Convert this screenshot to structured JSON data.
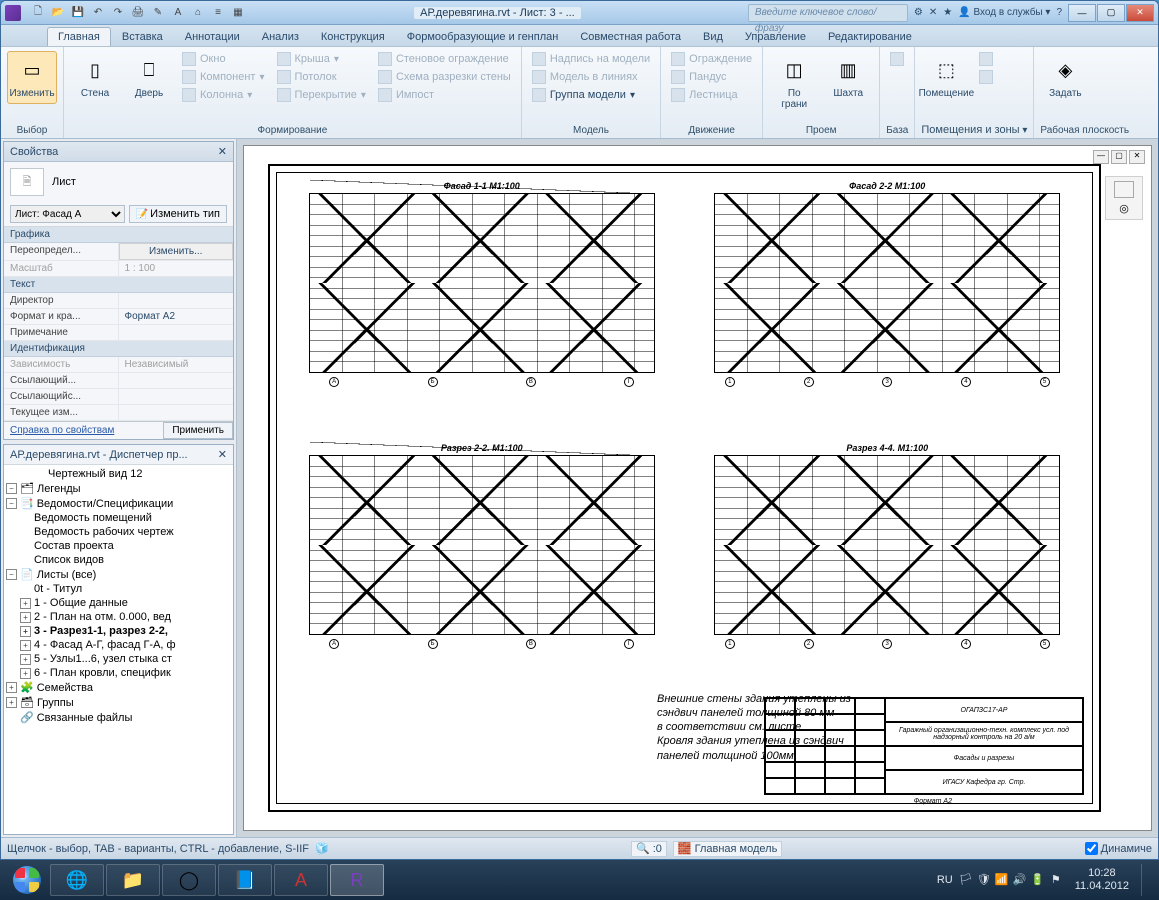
{
  "window": {
    "doc_title": "АР.деревягина.rvt - Лист: 3 - ...",
    "search_placeholder": "Введите ключевое слово/фразу",
    "signin": "Вход в службы",
    "help_glyph": "?"
  },
  "qat": [
    "🗋",
    "📂",
    "💾",
    "↶",
    "↷",
    "🖨",
    "✎",
    "A",
    "⌂",
    "≡",
    "▦"
  ],
  "tabs": [
    "Главная",
    "Вставка",
    "Аннотации",
    "Анализ",
    "Конструкция",
    "Формообразующие и генплан",
    "Совместная работа",
    "Вид",
    "Управление",
    "Редактирование"
  ],
  "ribbon": {
    "select": {
      "modify": "Изменить",
      "label": "Выбор"
    },
    "build": {
      "label": "Формирование",
      "items_col1": [
        "Стена",
        "Дверь"
      ],
      "items_col2": [
        "Окно",
        "Компонент",
        "Колонна"
      ],
      "items_col3": [
        "Крыша",
        "Потолок",
        "Перекрытие"
      ],
      "items_col4": [
        "Стеновое ограждение",
        "Схема разрезки стены",
        "Импост"
      ]
    },
    "model": {
      "label": "Модель",
      "items": [
        "Надпись на модели",
        "Модель в линиях",
        "Группа модели"
      ]
    },
    "move": {
      "label": "Движение",
      "items": [
        "Ограждение",
        "Пандус",
        "Лестница"
      ]
    },
    "open": {
      "label": "Проем",
      "items": [
        "По грани",
        "Шахта"
      ]
    },
    "base": {
      "label": "База"
    },
    "rooms": {
      "label": "Помещения и зоны",
      "btn": "Помещение"
    },
    "workplane": {
      "label": "Рабочая плоскость",
      "btn": "Задать"
    }
  },
  "props": {
    "title": "Свойства",
    "family": "Лист",
    "type_selector": "Лист: Фасад А",
    "edit_type": "Изменить тип",
    "groups": {
      "graphics": "Графика",
      "text": "Текст",
      "identity": "Идентификация"
    },
    "rows": {
      "override": {
        "k": "Переопредел...",
        "v": "Изменить..."
      },
      "scale": {
        "k": "Масштаб",
        "v": "1 : 100"
      },
      "director": {
        "k": "Директор",
        "v": ""
      },
      "format": {
        "k": "Формат и кра...",
        "v": "Формат А2"
      },
      "note": {
        "k": "Примечание",
        "v": ""
      },
      "depend": {
        "k": "Зависимость",
        "v": "Независимый"
      },
      "refby": {
        "k": "Ссылающий...",
        "v": ""
      },
      "refto": {
        "k": "Ссылающийс...",
        "v": ""
      },
      "current": {
        "k": "Текущее изм...",
        "v": ""
      }
    },
    "help_link": "Справка по свойствам",
    "apply": "Применить"
  },
  "browser": {
    "title": "АР.деревягина.rvt - Диспетчер пр...",
    "root_view": "Чертежный вид 12",
    "legends": "Легенды",
    "schedules": "Ведомости/Спецификации",
    "sched_items": [
      "Ведомость помещений",
      "Ведомость рабочих чертеж",
      "Состав проекта",
      "Список видов"
    ],
    "sheets": "Листы (все)",
    "sheet_items": [
      "0t - Титул",
      "1 - Общие данные",
      "2 - План на отм. 0.000, вед",
      "3 - Разрез1-1, разрез 2-2,",
      "4 - Фасад А-Г, фасад Г-А, ф",
      "5 - Узлы1...6, узел стыка ст",
      "6 - План кровли, специфик"
    ],
    "families": "Семейства",
    "groups": "Группы",
    "links": "Связанные файлы"
  },
  "sheet": {
    "view_titles": [
      "Фасад 1-1 М1:100",
      "Фасад 2-2 М1:100",
      "Разрез 2-2. М1:100",
      "Разрез 4-4. М1:100"
    ],
    "grid_axes": [
      "А",
      "Б",
      "В",
      "Г"
    ],
    "grid_nums": [
      "1",
      "2",
      "3",
      "4",
      "5"
    ],
    "project_code": "ОГАПЗС17-АР",
    "project_name": "Гаражный организационно-техн. комплекс усл. под надзорный контроль на 20 а/м",
    "sheet_title": "Фасады и разрезы",
    "org": "ИГАСУ Кафедра гр. Стр.",
    "format_lbl": "Формат А2",
    "note1": "Внешние стены здания утеплены из сэндвич панелей толщиной 80 мм",
    "note2": "в соответствии см. листе",
    "note3": "Кровля здания утеплена из сэндвич панелей толщиной 100мм"
  },
  "status": {
    "hint": "Щелчок - выбор, TAB - варианты, CTRL - добавление, S-IIF",
    "scale_val": ":0",
    "model": "Главная модель",
    "dynamic": "Динамиче"
  },
  "taskbar": {
    "lang": "RU",
    "clock_time": "10:28",
    "clock_date": "11.04.2012"
  }
}
